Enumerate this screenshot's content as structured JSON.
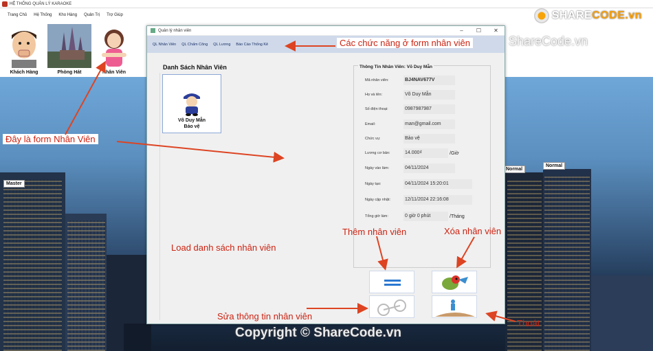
{
  "app": {
    "title": "HỆ THỐNG QUẢN LÝ KARAOKE",
    "menu": [
      "Trang Chủ",
      "Hệ Thống",
      "Kho Hàng",
      "Quản Trị",
      "Trợ Giúp"
    ]
  },
  "tiles": [
    {
      "label": "Khách Hàng"
    },
    {
      "label": "Phòng Hát"
    },
    {
      "label": "Nhân Viên"
    }
  ],
  "logo": {
    "prefix": "SHARE",
    "suffix": "CODE.vn"
  },
  "watermarks": {
    "top": "ShareCode.vn",
    "bottom": "Copyright © ShareCode.vn"
  },
  "tags": {
    "master": "Master",
    "normal1": "Normal",
    "normal2": "Normal"
  },
  "form": {
    "title": "Quản lý nhân viên",
    "window_buttons": [
      "–",
      "☐",
      "✕"
    ],
    "menu": [
      "QL Nhân Viên",
      "QL Chấm Công",
      "QL Lương",
      "Báo Cáo Thống Kê"
    ],
    "list_title": "Danh Sách Nhân Viên",
    "employee_card": {
      "name": "Võ Duy Mẫn",
      "role": "Bảo vệ"
    },
    "info_title": "Thông Tin Nhân Viên: Võ Duy Mẫn",
    "fields": [
      {
        "label": "Mã nhân viên:",
        "value": "BJ4NAV677V",
        "suffix": ""
      },
      {
        "label": "Họ và tên:",
        "value": "Võ Duy Mẫn",
        "suffix": ""
      },
      {
        "label": "Số điện thoại:",
        "value": "0987987987",
        "suffix": ""
      },
      {
        "label": "Email:",
        "value": "man@gmail.com",
        "suffix": ""
      },
      {
        "label": "Chức vụ:",
        "value": "Bảo vệ",
        "suffix": ""
      },
      {
        "label": "Lương cơ bản:",
        "value": "14.000₫",
        "suffix": "/Giờ"
      },
      {
        "label": "Ngày vào làm:",
        "value": "04/11/2024",
        "suffix": ""
      },
      {
        "label": "Ngày tạo:",
        "value": "04/11/2024 15:20:01",
        "suffix": ""
      },
      {
        "label": "Ngày cập nhật:",
        "value": "12/11/2024 22:16:08",
        "suffix": ""
      },
      {
        "label": "Tổng giờ làm:",
        "value": "0 giờ 0 phút",
        "suffix": "/Tháng"
      }
    ]
  },
  "annotations": {
    "functions": "Các chức năng ở form nhân viên",
    "form_label": "Đây là form Nhân Viên",
    "load_list": "Load danh sách nhân viên",
    "add": "Thêm nhân viên",
    "delete": "Xóa nhân viên",
    "edit": "Sửa thông tin nhân viên",
    "exit": "Thoát"
  },
  "colors": {
    "annotation": "#cc2211",
    "form_menu_bg": "#cfd9ea",
    "logo_accent": "#f59e0b"
  }
}
